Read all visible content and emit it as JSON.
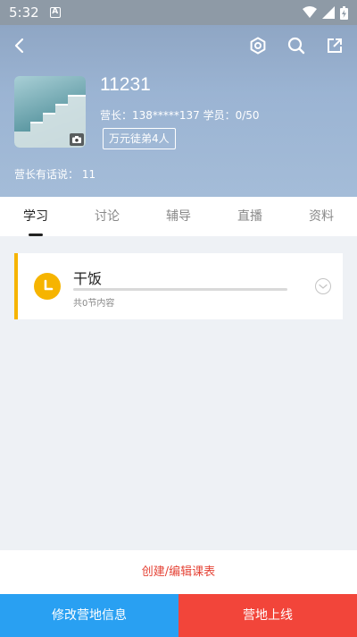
{
  "status_bar": {
    "time": "5:32",
    "notification_letter": "A"
  },
  "header": {
    "camp_name": "11231",
    "meta": "营长：138*****137  学员：0/50",
    "badge": "万元徒弟4人",
    "leader_says": "营长有话说：  11"
  },
  "tabs": [
    {
      "label": "学习",
      "active": true
    },
    {
      "label": "讨论",
      "active": false
    },
    {
      "label": "辅导",
      "active": false
    },
    {
      "label": "直播",
      "active": false
    },
    {
      "label": "资料",
      "active": false
    }
  ],
  "course": {
    "title": "干饭",
    "subtitle": "共0节内容",
    "progress": 0
  },
  "actions": {
    "create_edit": "创建/编辑课表",
    "edit_info": "修改营地信息",
    "go_online": "营地上线"
  },
  "colors": {
    "accent_yellow": "#f6b400",
    "blue_button": "#29a0f2",
    "red_button": "#f2453a",
    "link_red": "#e54437"
  }
}
